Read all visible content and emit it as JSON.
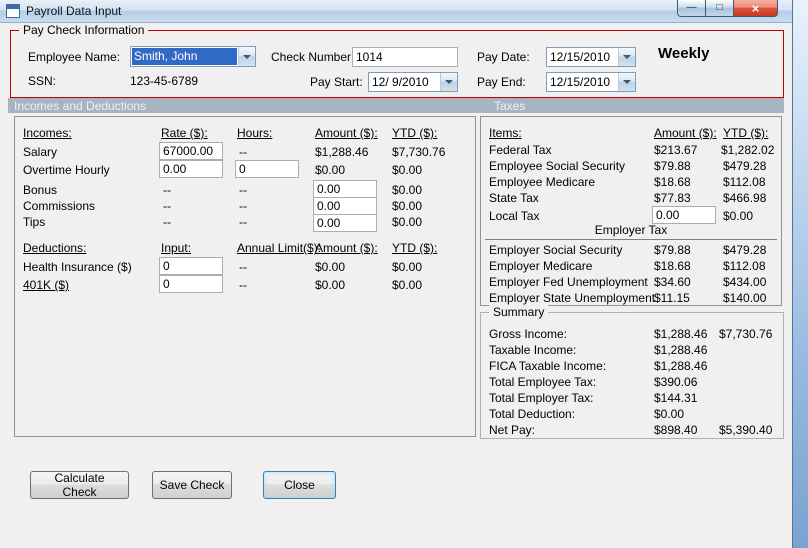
{
  "window": {
    "title": "Payroll Data Input",
    "minimize_glyph": "—",
    "maximize_glyph": "□",
    "close_glyph": "×"
  },
  "paycheck": {
    "group_label": "Pay Check Information",
    "employee_name_label": "Employee Name:",
    "employee_name_value": "Smith, John",
    "ssn_label": "SSN:",
    "ssn_value": "123-45-6789",
    "check_number_label": "Check Number:",
    "check_number_value": "1014",
    "pay_start_label": "Pay Start:",
    "pay_start_value": "12/ 9/2010",
    "pay_date_label": "Pay Date:",
    "pay_date_value": "12/15/2010",
    "pay_end_label": "Pay End:",
    "pay_end_value": "12/15/2010",
    "frequency": "Weekly"
  },
  "section_headers": {
    "left": "Incomes and Deductions",
    "right": "Taxes"
  },
  "incomes": {
    "header": {
      "name": "Incomes:",
      "rate": "Rate ($):",
      "hours": "Hours:",
      "amount": "Amount ($):",
      "ytd": "YTD ($):"
    },
    "salary": {
      "label": "Salary",
      "rate": "67000.00",
      "hours": "--",
      "amount": "$1,288.46",
      "ytd": "$7,730.76"
    },
    "overtime": {
      "label": "Overtime Hourly",
      "rate": "0.00",
      "hours": "0",
      "amount": "$0.00",
      "ytd": "$0.00"
    },
    "bonus": {
      "label": "Bonus",
      "rate": "--",
      "hours": "--",
      "amount": "0.00",
      "ytd": "$0.00"
    },
    "commissions": {
      "label": "Commissions",
      "rate": "--",
      "hours": "--",
      "amount": "0.00",
      "ytd": "$0.00"
    },
    "tips": {
      "label": "Tips",
      "rate": "--",
      "hours": "--",
      "amount": "0.00",
      "ytd": "$0.00"
    }
  },
  "deductions": {
    "header": {
      "name": "Deductions:",
      "input": "Input:",
      "limit": "Annual Limit($):",
      "amount": "Amount ($):",
      "ytd": "YTD ($):"
    },
    "health": {
      "label": "Health Insurance ($)",
      "input": "0",
      "limit": "--",
      "amount": "$0.00",
      "ytd": "$0.00"
    },
    "k401": {
      "label": "401K ($)",
      "input": "0",
      "limit": "--",
      "amount": "$0.00",
      "ytd": "$0.00"
    }
  },
  "taxes": {
    "header": {
      "items": "Items:",
      "amount": "Amount ($):",
      "ytd": "YTD ($):"
    },
    "rows": [
      {
        "label": "Federal Tax",
        "amount": "$213.67",
        "ytd": "$1,282.02"
      },
      {
        "label": "Employee Social Security",
        "amount": "$79.88",
        "ytd": "$479.28"
      },
      {
        "label": "Employee Medicare",
        "amount": "$18.68",
        "ytd": "$112.08"
      },
      {
        "label": "State Tax",
        "amount": "$77.83",
        "ytd": "$466.98"
      }
    ],
    "local": {
      "label": "Local Tax",
      "amount": "0.00",
      "ytd": "$0.00"
    },
    "employer_header": "Employer Tax",
    "employer_rows": [
      {
        "label": "Employer Social Security",
        "amount": "$79.88",
        "ytd": "$479.28"
      },
      {
        "label": "Employer Medicare",
        "amount": "$18.68",
        "ytd": "$112.08"
      },
      {
        "label": "Employer Fed Unemployment",
        "amount": "$34.60",
        "ytd": "$434.00"
      },
      {
        "label": "Employer State Unemployment",
        "amount": "$11.15",
        "ytd": "$140.00"
      }
    ]
  },
  "summary": {
    "group_label": "Summary",
    "rows": [
      {
        "label": "Gross Income:",
        "amount": "$1,288.46",
        "ytd": "$7,730.76"
      },
      {
        "label": "Taxable Income:",
        "amount": "$1,288.46",
        "ytd": ""
      },
      {
        "label": "FICA Taxable Income:",
        "amount": "$1,288.46",
        "ytd": ""
      },
      {
        "label": "Total Employee Tax:",
        "amount": "$390.06",
        "ytd": ""
      },
      {
        "label": "Total Employer Tax:",
        "amount": "$144.31",
        "ytd": ""
      },
      {
        "label": "Total Deduction:",
        "amount": "$0.00",
        "ytd": ""
      },
      {
        "label": "Net Pay:",
        "amount": "$898.40",
        "ytd": "$5,390.40"
      }
    ]
  },
  "buttons": {
    "calculate": "Calculate Check",
    "save": "Save Check",
    "close": "Close"
  }
}
